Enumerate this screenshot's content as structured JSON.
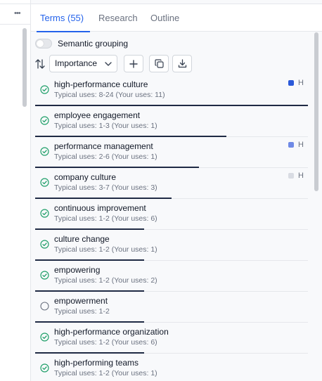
{
  "tabs": [
    {
      "label": "Terms (55)",
      "active": true
    },
    {
      "label": "Research",
      "active": false
    },
    {
      "label": "Outline",
      "active": false
    }
  ],
  "semantic_grouping": {
    "label": "Semantic grouping",
    "enabled": false
  },
  "sort": {
    "selected": "Importance"
  },
  "terms": [
    {
      "term": "high-performance culture",
      "uses": "Typical uses: 8-24 (Your uses: 11)",
      "status": "done",
      "importance": "H",
      "importance_color": "#2b59d9",
      "progress": 1.0
    },
    {
      "term": "employee engagement",
      "uses": "Typical uses: 1-3 (Your uses: 1)",
      "status": "done",
      "importance": "",
      "importance_color": "",
      "progress": 0.7
    },
    {
      "term": "performance management",
      "uses": "Typical uses: 2-6 (Your uses: 1)",
      "status": "done",
      "importance": "H",
      "importance_color": "#6f8ae6",
      "progress": 0.6
    },
    {
      "term": "company culture",
      "uses": "Typical uses: 3-7 (Your uses: 3)",
      "status": "done",
      "importance": "H",
      "importance_color": "#d9dce3",
      "progress": 0.5
    },
    {
      "term": "continuous improvement",
      "uses": "Typical uses: 1-2 (Your uses: 6)",
      "status": "done",
      "importance": "",
      "importance_color": "",
      "progress": 0.4
    },
    {
      "term": "culture change",
      "uses": "Typical uses: 1-2 (Your uses: 1)",
      "status": "done",
      "importance": "",
      "importance_color": "",
      "progress": 0.4
    },
    {
      "term": "empowering",
      "uses": "Typical uses: 1-2 (Your uses: 2)",
      "status": "done",
      "importance": "",
      "importance_color": "",
      "progress": 0.4
    },
    {
      "term": "empowerment",
      "uses": "Typical uses: 1-2",
      "status": "pending",
      "importance": "",
      "importance_color": "",
      "progress": 0.4
    },
    {
      "term": "high-performance organization",
      "uses": "Typical uses: 1-2 (Your uses: 6)",
      "status": "done",
      "importance": "",
      "importance_color": "",
      "progress": 0.4
    },
    {
      "term": "high-performing teams",
      "uses": "Typical uses: 1-2 (Your uses: 1)",
      "status": "done",
      "importance": "",
      "importance_color": "",
      "progress": 0.4
    }
  ],
  "colors": {
    "accent": "#2563eb",
    "check": "#22a06b",
    "progress": "#1f2a44"
  },
  "icons": {
    "more": "more-dots-icon",
    "sort": "sort-arrows-icon",
    "add": "plus-icon",
    "copy": "copy-icon",
    "download": "download-icon",
    "done": "check-circle-icon",
    "pending": "empty-circle-icon"
  }
}
